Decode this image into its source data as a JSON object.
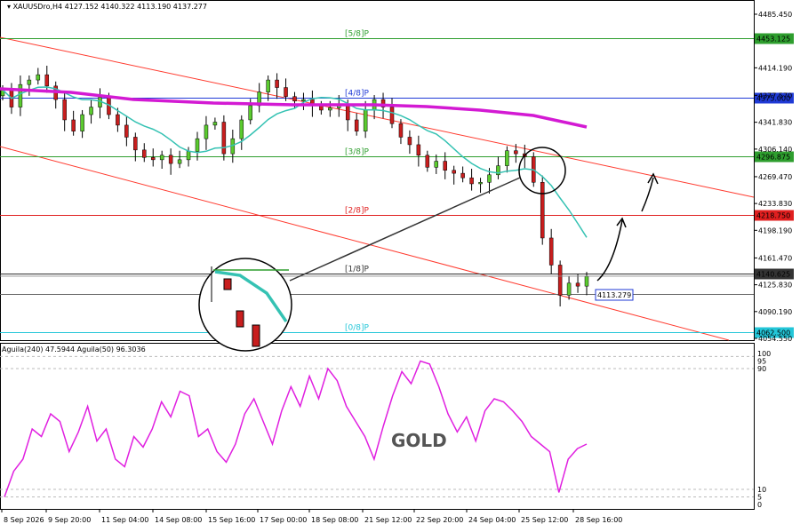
{
  "chart_data": {
    "type": "candlestick",
    "header": "XAUUSDro,H4  4127.152 4140.322 4113.190 4137.277",
    "price_axis": {
      "range": [
        4050,
        4500
      ],
      "ticks": [
        "4485.450",
        "4414.190",
        "4377.570",
        "4341.830",
        "4306.140",
        "4269.470",
        "4233.830",
        "4198.190",
        "4161.470",
        "4125.830",
        "4090.190",
        "4054.550"
      ]
    },
    "time_labels": [
      "8 Sep 2026",
      "9 Sep 20:00",
      "11 Sep 04:00",
      "14 Sep 08:00",
      "15 Sep 16:00",
      "17 Sep 00:00",
      "18 Sep 08:00",
      "21 Sep 12:00",
      "22 Sep 20:00",
      "24 Sep 04:00",
      "25 Sep 12:00",
      "28 Sep 16:00"
    ],
    "levels": [
      {
        "name": "[5/8]P",
        "price": 4453.125,
        "label": "4453.125",
        "color": "#2e9e2e"
      },
      {
        "name": "[4/8]P",
        "price": 4375.0,
        "label": "4375.000",
        "color": "#1f3ad6"
      },
      {
        "name": "[3/8]P",
        "price": 4296.875,
        "label": "4296.875",
        "color": "#2e9e2e"
      },
      {
        "name": "[2/8]P",
        "price": 4218.75,
        "label": "4218.750",
        "color": "#e01f1f"
      },
      {
        "name": "[1/8]P",
        "price": 4140.625,
        "label": "4140.625",
        "color": "#333333"
      },
      {
        "name": "[0/8]P",
        "price": 4062.5,
        "label": "4062.500",
        "color": "#23c6d8"
      }
    ],
    "current_price": "4137.277",
    "low_marker": "4113.279",
    "closes": [
      4385,
      4362,
      4392,
      4398,
      4405,
      4390,
      4372,
      4345,
      4330,
      4352,
      4362,
      4375,
      4352,
      4338,
      4322,
      4305,
      4295,
      4292,
      4298,
      4287,
      4292,
      4303,
      4320,
      4338,
      4342,
      4300,
      4320,
      4345,
      4364,
      4382,
      4398,
      4388,
      4376,
      4370,
      4372,
      4364,
      4358,
      4361,
      4366,
      4345,
      4330,
      4358,
      4372,
      4362,
      4340,
      4322,
      4312,
      4298,
      4282,
      4290,
      4278,
      4274,
      4268,
      4260,
      4262,
      4272,
      4284,
      4304,
      4300,
      4296,
      4262,
      4188,
      4152,
      4112,
      4128,
      4124,
      4137
    ],
    "indicator": {
      "label": "Aguila(240) 47.5944  Aguila(50) 96.3036",
      "ticks": [
        "100",
        "95",
        "90",
        "10",
        "5",
        "0"
      ],
      "series_name": "Aguila",
      "values": [
        5,
        22,
        30,
        50,
        45,
        60,
        55,
        35,
        48,
        65,
        42,
        50,
        30,
        25,
        45,
        38,
        50,
        68,
        58,
        75,
        72,
        45,
        50,
        35,
        28,
        40,
        60,
        70,
        55,
        40,
        62,
        78,
        65,
        85,
        70,
        90,
        82,
        65,
        55,
        45,
        30,
        52,
        72,
        88,
        80,
        95,
        93,
        78,
        60,
        48,
        58,
        42,
        62,
        70,
        68,
        62,
        55,
        45,
        40,
        35,
        8,
        30,
        37,
        40
      ]
    },
    "watermark": "GOLD"
  }
}
